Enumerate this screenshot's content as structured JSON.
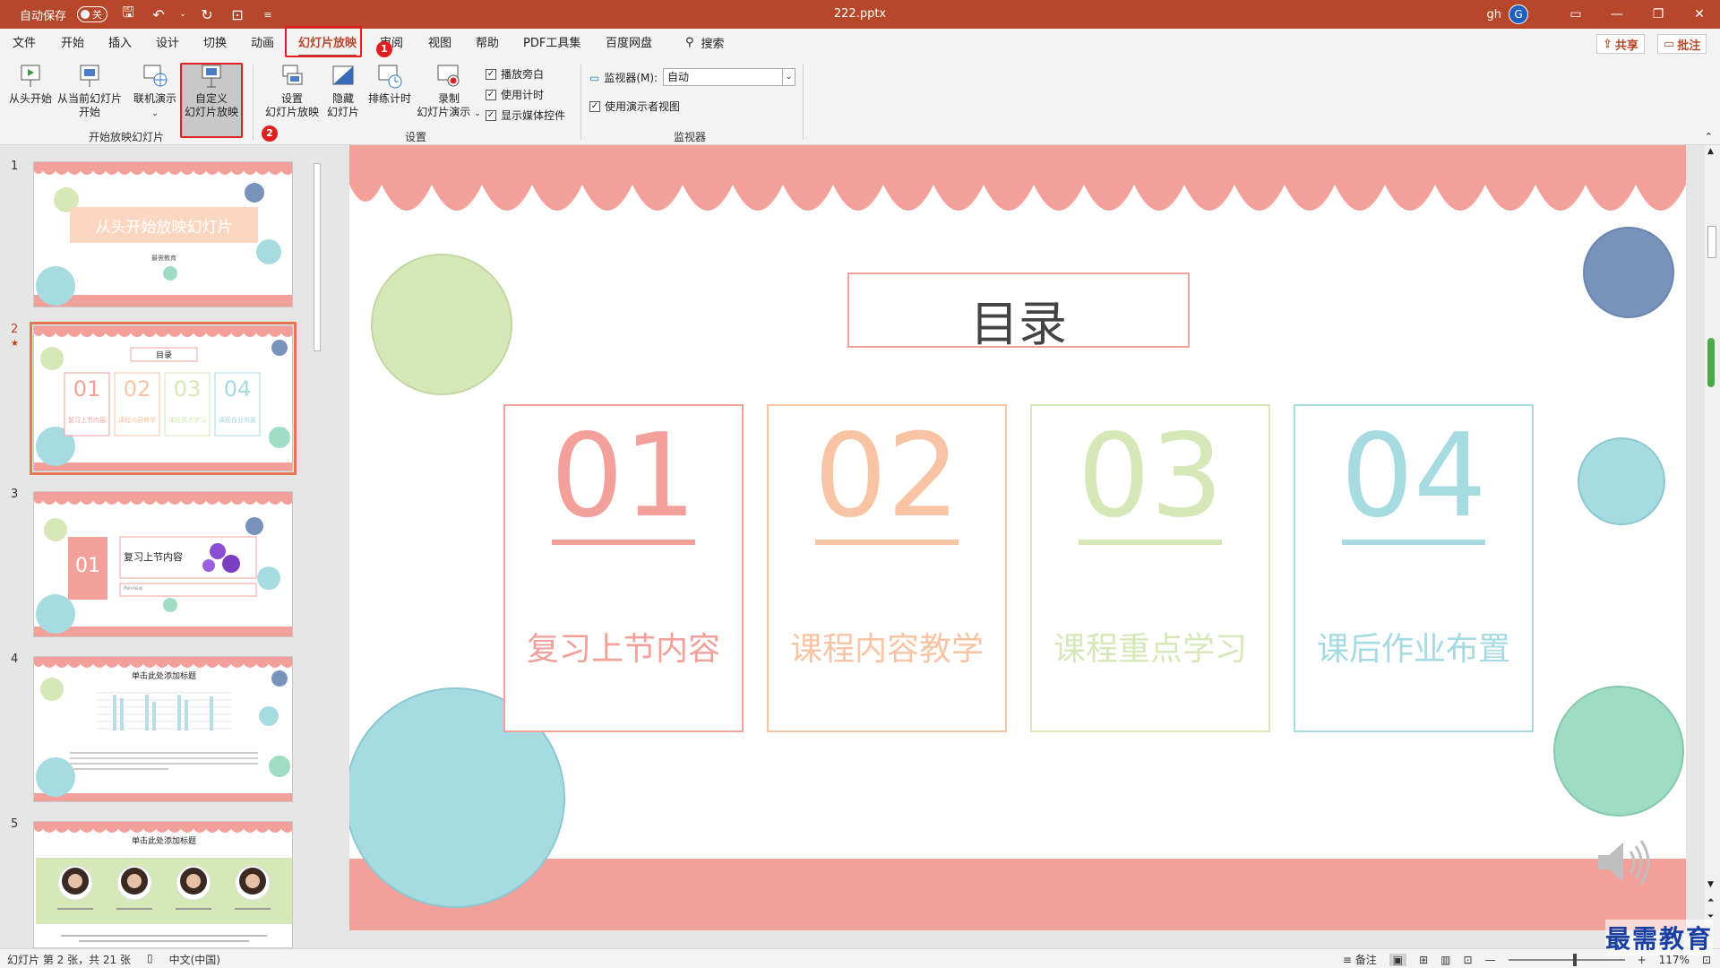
{
  "titlebar": {
    "autosave_label": "自动保存",
    "autosave_state": "关",
    "document_title": "222.pptx",
    "user_name": "gh",
    "avatar_initial": "G"
  },
  "menu": {
    "tabs": [
      "文件",
      "开始",
      "插入",
      "设计",
      "切换",
      "动画",
      "幻灯片放映",
      "审阅",
      "视图",
      "帮助",
      "PDF工具集",
      "百度网盘"
    ],
    "active_tab": "幻灯片放映",
    "search_label": "搜索",
    "share_label": "共享",
    "comment_label": "批注"
  },
  "ribbon": {
    "from_start_label": "从头开始",
    "from_current_label_1": "从当前幻灯片",
    "from_current_label_2": "开始",
    "online_label": "联机演示",
    "custom_label_1": "自定义",
    "custom_label_2": "幻灯片放映",
    "group_start_label": "开始放映幻灯片",
    "setup_label_1": "设置",
    "setup_label_2": "幻灯片放映",
    "hide_label_1": "隐藏",
    "hide_label_2": "幻灯片",
    "rehearse_label": "排练计时",
    "record_label_1": "录制",
    "record_label_2": "幻灯片演示",
    "play_narration": "播放旁白",
    "use_timings": "使用计时",
    "show_media": "显示媒体控件",
    "group_setup_label": "设置",
    "monitor_label": "监视器(M):",
    "monitor_value": "自动",
    "presenter_view": "使用演示者视图",
    "group_monitor_label": "监视器"
  },
  "annotations": {
    "badge_1": "1",
    "badge_2": "2"
  },
  "thumbnails": {
    "numbers": [
      "1",
      "2",
      "3",
      "4",
      "5"
    ],
    "star": "★",
    "t1_title": "从头开始放映幻灯片",
    "t1_sub": "最需教育",
    "t2_title": "目录",
    "t3_num": "01",
    "t3_title": "复习上节内容",
    "t3_sub": "Review",
    "t4_title": "单击此处添加标题",
    "t5_title": "单击此处添加标题"
  },
  "slide": {
    "title": "目录",
    "items": [
      {
        "num": "01",
        "label": "复习上节内容",
        "color": "#f4a09a"
      },
      {
        "num": "02",
        "label": "课程内容教学",
        "color": "#f9c4a4"
      },
      {
        "num": "03",
        "label": "课程重点学习",
        "color": "#d6e8b8"
      },
      {
        "num": "04",
        "label": "课后作业布置",
        "color": "#a6dbe2"
      }
    ]
  },
  "status": {
    "slide_info": "幻灯片 第 2 张，共 21 张",
    "language": "中文(中国)",
    "notes_label": "备注",
    "zoom": "117%"
  },
  "watermark": "最需教育",
  "colors": {
    "accent": "#b7472a",
    "salmon": "#f4a09a",
    "peach": "#f9c4a4",
    "green": "#d6e8b8",
    "teal": "#a6dbe2",
    "navy": "#7893bb",
    "mint": "#9fdcc4"
  }
}
